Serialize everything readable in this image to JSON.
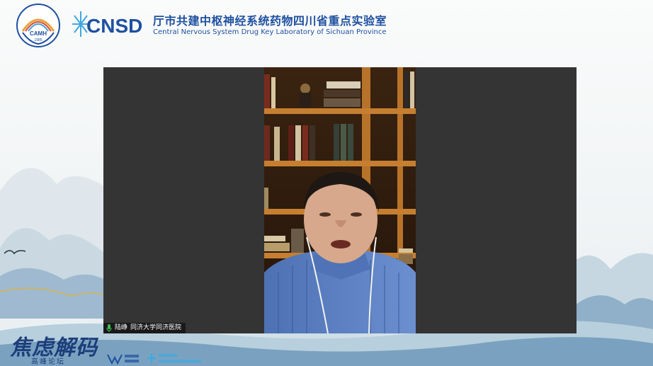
{
  "header": {
    "lab_title": "厅市共建中枢神经系统药物四川省重点实验室",
    "lab_subtitle": "Central Nervous System Drug Key Laboratory of Sichuan Province",
    "cnsd_logo_text": "CNSD",
    "camh_logo_text": "CAMH",
    "camh_logo_year": "1985"
  },
  "video": {
    "participant_name": "陆峥",
    "participant_org": "同济大学同济医院"
  },
  "footer": {
    "forum_title": "焦虑解码",
    "forum_subtitle": "高峰论坛"
  },
  "icons": {
    "mic": "microphone-icon",
    "bird": "bird-icon"
  },
  "colors": {
    "brand_blue": "#1e50a0",
    "video_bg": "#343434",
    "mic_green": "#3fbf4f"
  }
}
